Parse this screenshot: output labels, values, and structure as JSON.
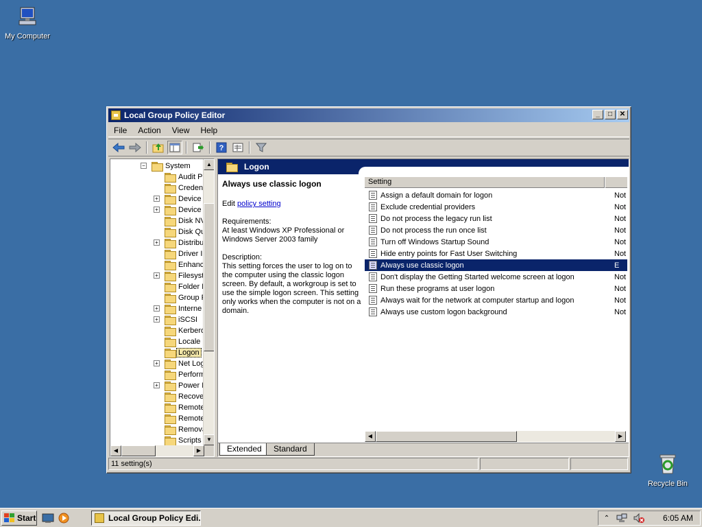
{
  "desktop": {
    "icons": [
      {
        "label": "My Computer"
      },
      {
        "label": "Recycle Bin"
      }
    ]
  },
  "window": {
    "title": "Local Group Policy Editor",
    "buttons": {
      "minimize": "_",
      "maximize": "□",
      "close": "✕"
    },
    "menu": [
      "File",
      "Action",
      "View",
      "Help"
    ],
    "toolbar_icons": [
      "back-arrow-icon",
      "forward-arrow-icon",
      "up-folder-icon",
      "show-hide-tree-icon",
      "export-list-icon",
      "help-icon",
      "properties-icon",
      "filter-icon"
    ]
  },
  "tree": {
    "items": [
      {
        "label": "System",
        "expander": "−"
      },
      {
        "label": "Audit Pr",
        "expander": ""
      },
      {
        "label": "Creden",
        "expander": ""
      },
      {
        "label": "Device I",
        "expander": "+"
      },
      {
        "label": "Device R",
        "expander": "+"
      },
      {
        "label": "Disk NV",
        "expander": ""
      },
      {
        "label": "Disk Qu",
        "expander": ""
      },
      {
        "label": "Distribu",
        "expander": "+"
      },
      {
        "label": "Driver I",
        "expander": ""
      },
      {
        "label": "Enhanc",
        "expander": ""
      },
      {
        "label": "Filesyst",
        "expander": "+"
      },
      {
        "label": "Folder R",
        "expander": ""
      },
      {
        "label": "Group P",
        "expander": ""
      },
      {
        "label": "Interne",
        "expander": "+"
      },
      {
        "label": "iSCSI",
        "expander": "+"
      },
      {
        "label": "Kerbero",
        "expander": ""
      },
      {
        "label": "Locale S",
        "expander": ""
      },
      {
        "label": "Logon",
        "expander": "",
        "selected": true
      },
      {
        "label": "Net Log",
        "expander": "+"
      },
      {
        "label": "Perform",
        "expander": ""
      },
      {
        "label": "Power M",
        "expander": "+"
      },
      {
        "label": "Recove",
        "expander": ""
      },
      {
        "label": "Remote",
        "expander": ""
      },
      {
        "label": "Remote",
        "expander": ""
      },
      {
        "label": "Remova",
        "expander": ""
      },
      {
        "label": "Scripts",
        "expander": ""
      }
    ]
  },
  "right": {
    "header": "Logon",
    "desc": {
      "title": "Always use classic logon",
      "edit_prefix": "Edit ",
      "edit_link": "policy setting",
      "req_label": "Requirements:",
      "req_text": "At least Windows XP Professional or Windows Server 2003 family",
      "desc_label": "Description:",
      "desc_text": "This setting forces the user to log on to the computer using the classic logon screen. By default, a workgroup is set to use the simple logon screen. This setting only works when the computer is not on a domain."
    },
    "column_setting": "Setting",
    "rows": [
      {
        "name": "Assign a default domain for logon",
        "state": "Not c"
      },
      {
        "name": "Exclude credential providers",
        "state": "Not c"
      },
      {
        "name": "Do not process the legacy run list",
        "state": "Not c"
      },
      {
        "name": "Do not process the run once list",
        "state": "Not c"
      },
      {
        "name": "Turn off Windows Startup Sound",
        "state": "Not c"
      },
      {
        "name": "Hide entry points for Fast User Switching",
        "state": "Not c"
      },
      {
        "name": "Always use classic logon",
        "state": "E",
        "selected": true
      },
      {
        "name": "Don't display the Getting Started welcome screen at logon",
        "state": "Not c"
      },
      {
        "name": "Run these programs at user logon",
        "state": "Not c"
      },
      {
        "name": "Always wait for the network at computer startup and logon",
        "state": "Not c"
      },
      {
        "name": "Always use custom logon background",
        "state": "Not c"
      }
    ],
    "tabs": [
      "Extended",
      "Standard"
    ]
  },
  "status": {
    "text": "11 setting(s)"
  },
  "taskbar": {
    "start": "Start",
    "task": "Local Group Policy Edi...",
    "clock": "6:05 AM"
  },
  "colors": {
    "desktop": "#3a6ea5",
    "selection": "#0a246a"
  }
}
